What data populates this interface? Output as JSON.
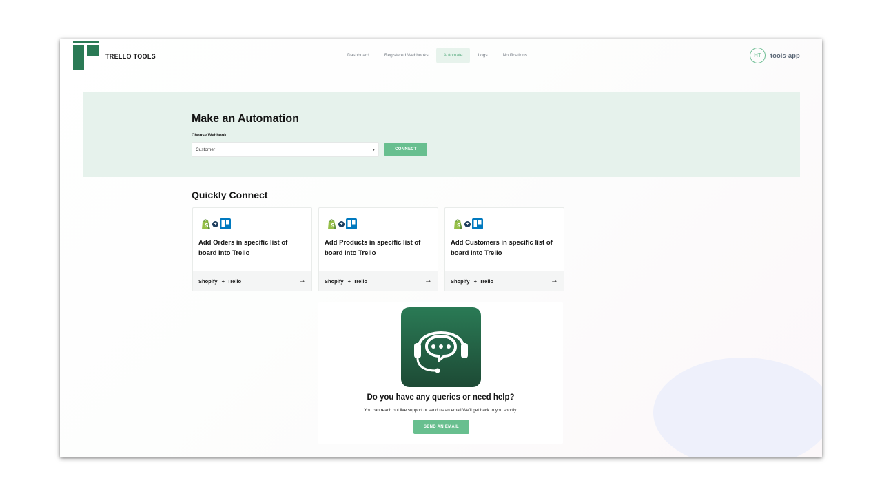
{
  "app": {
    "brand": "TRELLO TOOLS",
    "brand_color": "#2a7a55",
    "accent_color": "#68bf8f"
  },
  "nav": {
    "items": [
      {
        "label": "Dashboard",
        "active": false
      },
      {
        "label": "Registered Webhooks",
        "active": false
      },
      {
        "label": "Automate",
        "active": true
      },
      {
        "label": "Logs",
        "active": false
      },
      {
        "label": "Notifications",
        "active": false
      }
    ]
  },
  "user": {
    "initials": "HT",
    "name": "tools-app"
  },
  "automation": {
    "title": "Make an Automation",
    "webhook_label": "Choose Webhook",
    "webhook_value": "Customer",
    "connect_label": "CONNECT"
  },
  "quick_connect": {
    "title": "Quickly Connect",
    "cards": [
      {
        "title": "Add Orders in specific list of board into Trello",
        "from": "Shopify",
        "plus": "+",
        "to": "Trello",
        "icons": [
          "shopify-icon",
          "plus-icon",
          "trello-icon"
        ],
        "arrow": "→"
      },
      {
        "title": "Add Products in specific list of board into Trello",
        "from": "Shopify",
        "plus": "+",
        "to": "Trello",
        "icons": [
          "shopify-icon",
          "plus-icon",
          "trello-icon"
        ],
        "arrow": "→"
      },
      {
        "title": "Add Customers in specific list of board into Trello",
        "from": "Shopify",
        "plus": "+",
        "to": "Trello",
        "icons": [
          "shopify-icon",
          "plus-icon",
          "trello-icon"
        ],
        "arrow": "→"
      }
    ]
  },
  "help": {
    "icon": "support-headset-icon",
    "title": "Do you have any queries or need help?",
    "subtitle": "You can reach out live support or send us an email.We'll get back to you shortly.",
    "button_label": "SEND AN EMAIL"
  }
}
